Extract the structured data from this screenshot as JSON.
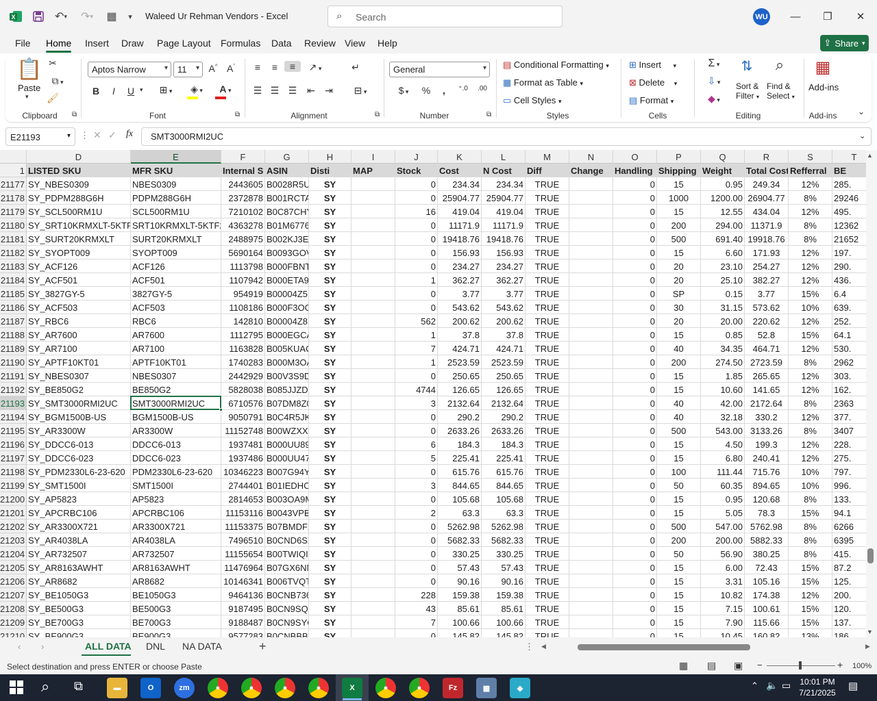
{
  "window": {
    "title": "Waleed Ur Rehman Vendors  -  Excel",
    "search_placeholder": "Search",
    "user_initials": "WU"
  },
  "menu": [
    "File",
    "Home",
    "Insert",
    "Draw",
    "Page Layout",
    "Formulas",
    "Data",
    "Review",
    "View",
    "Help"
  ],
  "share_label": "Share",
  "ribbon": {
    "clipboard": {
      "label": "Clipboard",
      "paste": "Paste"
    },
    "font": {
      "label": "Font",
      "family": "Aptos Narrow",
      "size": "11",
      "bold": "B",
      "italic": "I",
      "underline": "U"
    },
    "alignment": {
      "label": "Alignment"
    },
    "number": {
      "label": "Number",
      "format": "General"
    },
    "styles": {
      "label": "Styles",
      "conditional": "Conditional Formatting",
      "format_table": "Format as Table",
      "cell_styles": "Cell Styles"
    },
    "cells": {
      "label": "Cells",
      "insert": "Insert",
      "delete": "Delete",
      "format": "Format"
    },
    "editing": {
      "label": "Editing",
      "sort": "Sort &",
      "filter": "Filter",
      "find": "Find &",
      "select": "Select"
    },
    "addins": {
      "label": "Add-ins",
      "addins": "Add-ins"
    }
  },
  "formula_bar": {
    "name_box": "E21193",
    "fx": "fx",
    "value": "SMT3000RMI2UC"
  },
  "columns": [
    "D",
    "E",
    "F",
    "G",
    "H",
    "I",
    "J",
    "K",
    "L",
    "M",
    "N",
    "O",
    "P",
    "Q",
    "R",
    "S",
    "T"
  ],
  "header_row": {
    "num": "1",
    "cells": [
      "LISTED SKU",
      "MFR SKU",
      "Internal S",
      "ASIN",
      "Disti",
      "MAP",
      "Stock",
      "Cost",
      "N Cost",
      "Diff",
      "Change",
      "Handling",
      "Shipping",
      "Weight",
      "Total Cost",
      "Refferral",
      "BE"
    ]
  },
  "rows": [
    [
      "21177",
      "SY_NBES0309",
      "NBES0309",
      "2443605",
      "B0028R5U",
      "SY",
      "",
      "0",
      "234.34",
      "234.34",
      "TRUE",
      "",
      "0",
      "15",
      "0.95",
      "249.34",
      "12%",
      "285."
    ],
    [
      "21178",
      "SY_PDPM288G6H",
      "PDPM288G6H",
      "2372878",
      "B001RCTA",
      "SY",
      "",
      "0",
      "25904.77",
      "25904.77",
      "TRUE",
      "",
      "0",
      "1000",
      "1200.00",
      "26904.77",
      "8%",
      "29246"
    ],
    [
      "21179",
      "SY_SCL500RM1U",
      "SCL500RM1U",
      "7210102",
      "B0C87CHY",
      "SY",
      "",
      "16",
      "419.04",
      "419.04",
      "TRUE",
      "",
      "0",
      "15",
      "12.55",
      "434.04",
      "12%",
      "495."
    ],
    [
      "21180",
      "SY_SRT10KRMXLT-5KTF2",
      "SRT10KRMXLT-5KTF2",
      "4363278",
      "B01M6776",
      "SY",
      "",
      "0",
      "11171.9",
      "11171.9",
      "TRUE",
      "",
      "0",
      "200",
      "294.00",
      "11371.9",
      "8%",
      "12362"
    ],
    [
      "21181",
      "SY_SURT20KRMXLT",
      "SURT20KRMXLT",
      "2488975",
      "B002KJ3EA",
      "SY",
      "",
      "0",
      "19418.76",
      "19418.76",
      "TRUE",
      "",
      "0",
      "500",
      "691.40",
      "19918.76",
      "8%",
      "21652"
    ],
    [
      "21182",
      "SY_SYOPT009",
      "SYOPT009",
      "5690164",
      "B0093GOV",
      "SY",
      "",
      "0",
      "156.93",
      "156.93",
      "TRUE",
      "",
      "0",
      "15",
      "6.60",
      "171.93",
      "12%",
      "197."
    ],
    [
      "21183",
      "SY_ACF126",
      "ACF126",
      "1113798",
      "B000FBNT",
      "SY",
      "",
      "0",
      "234.27",
      "234.27",
      "TRUE",
      "",
      "0",
      "20",
      "23.10",
      "254.27",
      "12%",
      "290."
    ],
    [
      "21184",
      "SY_ACF501",
      "ACF501",
      "1107942",
      "B000ETA9",
      "SY",
      "",
      "1",
      "362.27",
      "362.27",
      "TRUE",
      "",
      "0",
      "20",
      "25.10",
      "382.27",
      "12%",
      "436."
    ],
    [
      "21185",
      "SY_3827GY-5",
      "3827GY-5",
      "954919",
      "B00004Z5",
      "SY",
      "",
      "0",
      "3.77",
      "3.77",
      "TRUE",
      "",
      "0",
      "SP",
      "0.15",
      "3.77",
      "15%",
      "6.4"
    ],
    [
      "21186",
      "SY_ACF503",
      "ACF503",
      "1108186",
      "B000F3OG",
      "SY",
      "",
      "0",
      "543.62",
      "543.62",
      "TRUE",
      "",
      "0",
      "30",
      "31.15",
      "573.62",
      "10%",
      "639."
    ],
    [
      "21187",
      "SY_RBC6",
      "RBC6",
      "142810",
      "B00004Z8",
      "SY",
      "",
      "562",
      "200.62",
      "200.62",
      "TRUE",
      "",
      "0",
      "20",
      "20.00",
      "220.62",
      "12%",
      "252."
    ],
    [
      "21188",
      "SY_AR7600",
      "AR7600",
      "1112795",
      "B000EGCA",
      "SY",
      "",
      "1",
      "37.8",
      "37.8",
      "TRUE",
      "",
      "0",
      "15",
      "0.85",
      "52.8",
      "15%",
      "64.1"
    ],
    [
      "21189",
      "SY_AR7100",
      "AR7100",
      "1163828",
      "B005KUAC",
      "SY",
      "",
      "7",
      "424.71",
      "424.71",
      "TRUE",
      "",
      "0",
      "40",
      "34.35",
      "464.71",
      "12%",
      "530."
    ],
    [
      "21190",
      "SY_APTF10KT01",
      "APTF10KT01",
      "1740283",
      "B000M3OA",
      "SY",
      "",
      "1",
      "2523.59",
      "2523.59",
      "TRUE",
      "",
      "0",
      "200",
      "274.50",
      "2723.59",
      "8%",
      "2962"
    ],
    [
      "21191",
      "SY_NBES0307",
      "NBES0307",
      "2442929",
      "B00V3S9D",
      "SY",
      "",
      "0",
      "250.65",
      "250.65",
      "TRUE",
      "",
      "0",
      "15",
      "1.85",
      "265.65",
      "12%",
      "303."
    ],
    [
      "21192",
      "SY_BE850G2",
      "BE850G2",
      "5828038",
      "B085JJZDF",
      "SY",
      "",
      "4744",
      "126.65",
      "126.65",
      "TRUE",
      "",
      "0",
      "15",
      "10.60",
      "141.65",
      "12%",
      "162."
    ],
    [
      "21193",
      "SY_SMT3000RMI2UC",
      "SMT3000RMI2UC",
      "6710576",
      "B07DM8Z0",
      "SY",
      "",
      "3",
      "2132.64",
      "2132.64",
      "TRUE",
      "",
      "0",
      "40",
      "42.00",
      "2172.64",
      "8%",
      "2363"
    ],
    [
      "21194",
      "SY_BGM1500B-US",
      "BGM1500B-US",
      "9050791",
      "B0C4R5JK7",
      "SY",
      "",
      "0",
      "290.2",
      "290.2",
      "TRUE",
      "",
      "0",
      "40",
      "32.18",
      "330.2",
      "12%",
      "377."
    ],
    [
      "21195",
      "SY_AR3300W",
      "AR3300W",
      "11152748",
      "B00WZXXU",
      "SY",
      "",
      "0",
      "2633.26",
      "2633.26",
      "TRUE",
      "",
      "0",
      "500",
      "543.00",
      "3133.26",
      "8%",
      "3407"
    ],
    [
      "21196",
      "SY_DDCC6-013",
      "DDCC6-013",
      "1937481",
      "B000UU89",
      "SY",
      "",
      "6",
      "184.3",
      "184.3",
      "TRUE",
      "",
      "0",
      "15",
      "4.50",
      "199.3",
      "12%",
      "228."
    ],
    [
      "21197",
      "SY_DDCC6-023",
      "DDCC6-023",
      "1937486",
      "B000UU47",
      "SY",
      "",
      "5",
      "225.41",
      "225.41",
      "TRUE",
      "",
      "0",
      "15",
      "6.80",
      "240.41",
      "12%",
      "275."
    ],
    [
      "21198",
      "SY_PDM2330L6-23-620",
      "PDM2330L6-23-620",
      "10346223",
      "B007G94Y",
      "SY",
      "",
      "0",
      "615.76",
      "615.76",
      "TRUE",
      "",
      "0",
      "100",
      "111.44",
      "715.76",
      "10%",
      "797."
    ],
    [
      "21199",
      "SY_SMT1500I",
      "SMT1500I",
      "2744401",
      "B01IEDHO",
      "SY",
      "",
      "3",
      "844.65",
      "844.65",
      "TRUE",
      "",
      "0",
      "50",
      "60.35",
      "894.65",
      "10%",
      "996."
    ],
    [
      "21200",
      "SY_AP5823",
      "AP5823",
      "2814653",
      "B003OA9M",
      "SY",
      "",
      "0",
      "105.68",
      "105.68",
      "TRUE",
      "",
      "0",
      "15",
      "0.95",
      "120.68",
      "8%",
      "133."
    ],
    [
      "21201",
      "SY_APCRBC106",
      "APCRBC106",
      "11153116",
      "B0043VPB",
      "SY",
      "",
      "2",
      "63.3",
      "63.3",
      "TRUE",
      "",
      "0",
      "15",
      "5.05",
      "78.3",
      "15%",
      "94.1"
    ],
    [
      "21202",
      "SY_AR3300X721",
      "AR3300X721",
      "11153375",
      "B07BMDF2",
      "SY",
      "",
      "0",
      "5262.98",
      "5262.98",
      "TRUE",
      "",
      "0",
      "500",
      "547.00",
      "5762.98",
      "8%",
      "6266"
    ],
    [
      "21203",
      "SY_AR4038LA",
      "AR4038LA",
      "7496510",
      "B0CND6SX",
      "SY",
      "",
      "0",
      "5682.33",
      "5682.33",
      "TRUE",
      "",
      "0",
      "200",
      "200.00",
      "5882.33",
      "8%",
      "6395"
    ],
    [
      "21204",
      "SY_AR732507",
      "AR732507",
      "11155654",
      "B00TWIQI",
      "SY",
      "",
      "0",
      "330.25",
      "330.25",
      "TRUE",
      "",
      "0",
      "50",
      "56.90",
      "380.25",
      "8%",
      "415."
    ],
    [
      "21205",
      "SY_AR8163AWHT",
      "AR8163AWHT",
      "11476964",
      "B07GX6NN",
      "SY",
      "",
      "0",
      "57.43",
      "57.43",
      "TRUE",
      "",
      "0",
      "15",
      "6.00",
      "72.43",
      "15%",
      "87.2"
    ],
    [
      "21206",
      "SY_AR8682",
      "AR8682",
      "10146341",
      "B006TVQT",
      "SY",
      "",
      "0",
      "90.16",
      "90.16",
      "TRUE",
      "",
      "0",
      "15",
      "3.31",
      "105.16",
      "15%",
      "125."
    ],
    [
      "21207",
      "SY_BE1050G3",
      "BE1050G3",
      "9464136",
      "B0CNB736",
      "SY",
      "",
      "228",
      "159.38",
      "159.38",
      "TRUE",
      "",
      "0",
      "15",
      "10.82",
      "174.38",
      "12%",
      "200."
    ],
    [
      "21208",
      "SY_BE500G3",
      "BE500G3",
      "9187495",
      "B0CN9SQK",
      "SY",
      "",
      "43",
      "85.61",
      "85.61",
      "TRUE",
      "",
      "0",
      "15",
      "7.15",
      "100.61",
      "15%",
      "120."
    ],
    [
      "21209",
      "SY_BE700G3",
      "BE700G3",
      "9188487",
      "B0CN9SYQ",
      "SY",
      "",
      "7",
      "100.66",
      "100.66",
      "TRUE",
      "",
      "0",
      "15",
      "7.90",
      "115.66",
      "15%",
      "137."
    ],
    [
      "21210",
      "SY_BE900G3",
      "BE900G3",
      "9577283",
      "B0CNBBB3",
      "SY",
      "",
      "0",
      "145.82",
      "145.82",
      "TRUE",
      "",
      "0",
      "15",
      "10.45",
      "160.82",
      "13%",
      "186"
    ]
  ],
  "sheets": [
    "ALL DATA",
    "DNL",
    "NA DATA"
  ],
  "status": {
    "text": "Select destination and press ENTER or choose Paste",
    "zoom": "100%"
  },
  "taskbar": {
    "time": "10:01 PM",
    "date": "7/21/2025"
  }
}
